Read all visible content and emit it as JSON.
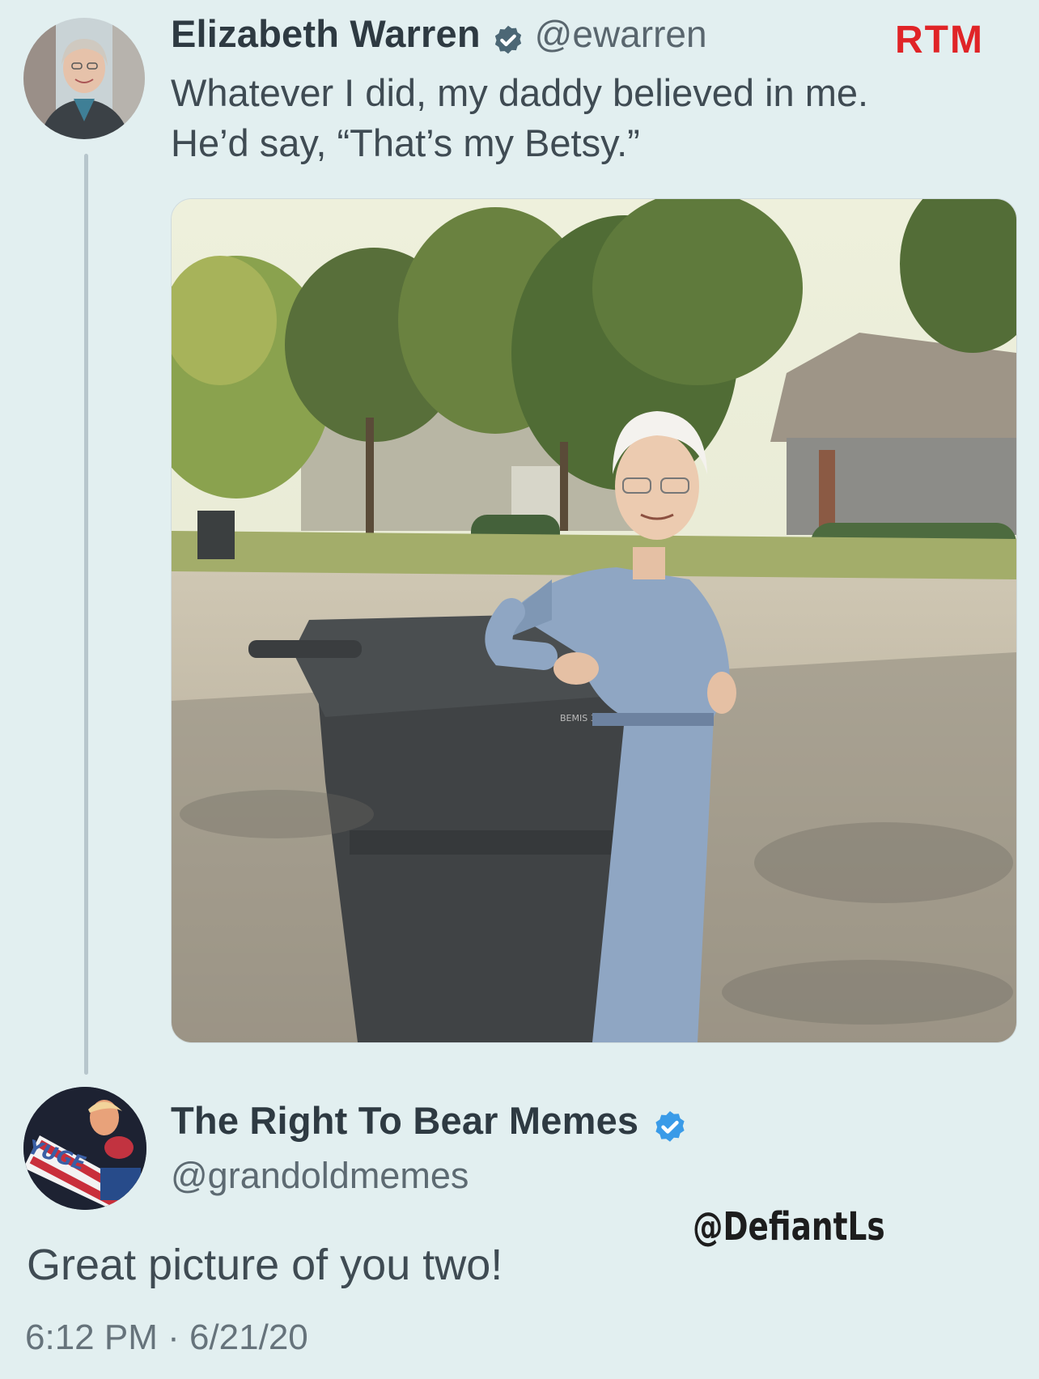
{
  "tweet1": {
    "display_name": "Elizabeth Warren",
    "handle": "@ewarren",
    "verified_icon": "verified-badge-icon",
    "text_line1": "Whatever I did, my daddy believed in me.",
    "text_line2": "He’d say, “That’s my Betsy.”",
    "photo_bin_label": "BEMIS 345",
    "colors": {
      "badge": "#4c6775"
    }
  },
  "watermark_top": "RTM",
  "reply": {
    "display_name": "The Right To Bear Memes",
    "handle": "@grandoldmemes",
    "avatar_text": "YUGE",
    "verified_icon": "verified-badge-icon",
    "text": "Great picture of you two!",
    "timestamp": "6:12 PM · 6/21/20",
    "colors": {
      "badge": "#3a9be8"
    }
  },
  "watermark_bottom": "@DefiantLs"
}
